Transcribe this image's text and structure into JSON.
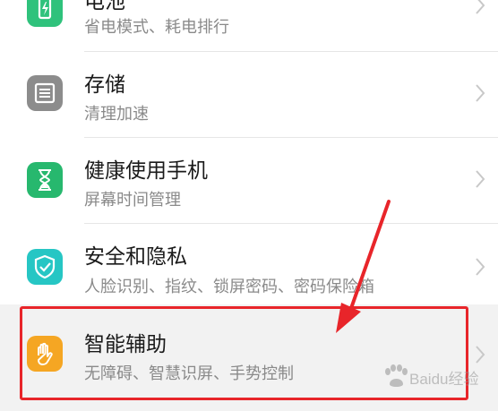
{
  "settings": {
    "items": [
      {
        "title": "电池",
        "subtitle": "省电模式、耗电排行",
        "icon": "battery-icon",
        "icon_color": "#2fc27c"
      },
      {
        "title": "存储",
        "subtitle": "清理加速",
        "icon": "storage-icon",
        "icon_color": "#8c8c8c"
      },
      {
        "title": "健康使用手机",
        "subtitle": "屏幕时间管理",
        "icon": "hourglass-icon",
        "icon_color": "#27b86e"
      },
      {
        "title": "安全和隐私",
        "subtitle": "人脸识别、指纹、锁屏密码、密码保险箱",
        "icon": "shield-icon",
        "icon_color": "#26c6c4"
      },
      {
        "title": "智能辅助",
        "subtitle": "无障碍、智慧识屏、手势控制",
        "icon": "hand-icon",
        "icon_color": "#f5a623"
      }
    ]
  },
  "annotation": {
    "highlight_color": "#e8252a"
  },
  "watermark": {
    "text": "Baidu经验"
  }
}
